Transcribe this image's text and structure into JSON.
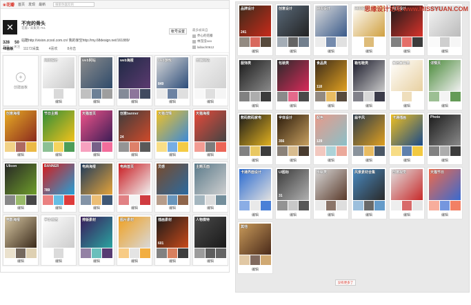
{
  "watermark": "思缘设计论坛 www.MISSYUAN.COM",
  "topbar": {
    "logo": "❀花瓣",
    "nav": [
      "首页",
      "发现",
      "最新"
    ],
    "search_placeholder": "搜索你喜欢的"
  },
  "profile": {
    "avatar_glyph": "✕",
    "name": "不完的骨头",
    "home": "花瓣 / 采集到:761",
    "desc": "站酷http://vision.zcool.com.cn/ 我的家空http://my.68design.net/161889/",
    "stats": [
      {
        "value": "328",
        "label": "粉丝"
      },
      {
        "value": "50",
        "label": "关注"
      }
    ],
    "account_button": "帐号设置",
    "followers_title": "最多被采自",
    "followers": [
      "乔心的花瓣",
      "林滢滢ooo",
      "laibach0612"
    ]
  },
  "tabs": [
    "48画板",
    "11172采集",
    "4喜欢",
    "8点击"
  ],
  "create_label": "创建画板",
  "edit_label": "编辑",
  "left_boards": [
    {
      "title": "网页设计",
      "count": "",
      "c1": "#ffffff",
      "c2": "#c9c9c9"
    },
    {
      "title": "web网站",
      "count": "",
      "c1": "#8d8d8d",
      "c2": "#2e4a6a"
    },
    {
      "title": "web海报",
      "count": "",
      "c1": "#1e2a44",
      "c2": "#5c3a70"
    },
    {
      "title": "web游戏",
      "count": "849",
      "c1": "#d9d9d9",
      "c2": "#2d4d7a"
    },
    {
      "title": "日韩网站",
      "count": "",
      "c1": "#f3f3f3",
      "c2": "#d2d2d2"
    },
    {
      "title": "创意海报",
      "count": "",
      "c1": "#e8ad24",
      "c2": "#8b2a1e"
    },
    {
      "title": "节日主题",
      "count": "",
      "c1": "#2e8c3a",
      "c2": "#f2c21a"
    },
    {
      "title": "天猫首页",
      "count": "",
      "c1": "#f0548a",
      "c2": "#3d1d56"
    },
    {
      "title": "创意banner",
      "count": "24",
      "c1": "#3c3c3c",
      "c2": "#d04a2a"
    },
    {
      "title": "天猫详情",
      "count": "",
      "c1": "#f2c224",
      "c2": "#3c8ad8"
    },
    {
      "title": "天猫海报",
      "count": "",
      "c1": "#e84a3a",
      "c2": "#444444"
    },
    {
      "title": "Ulicon",
      "count": "",
      "c1": "#262626",
      "c2": "#6e9d2a"
    },
    {
      "title": "BANNER",
      "count": "789",
      "c1": "#d81a1a",
      "c2": "#24a1d8"
    },
    {
      "title": "电商海报",
      "count": "",
      "c1": "#1d3a5c",
      "c2": "#e4a33a"
    },
    {
      "title": "电商首页",
      "count": "",
      "c1": "#c8191f",
      "c2": "#f0f0f0"
    },
    {
      "title": "灵感",
      "count": "",
      "c1": "#7a4a2a",
      "c2": "#2a6aa0"
    },
    {
      "title": "主题页面",
      "count": "",
      "c1": "#5a7a8a",
      "c2": "#cfcfcf"
    },
    {
      "title": "电影海报",
      "count": "",
      "c1": "#d8c8a4",
      "c2": "#3a2a1a"
    },
    {
      "title": "字体标志",
      "count": "",
      "c1": "#ffffff",
      "c2": "#cccccc"
    },
    {
      "title": "排版素材",
      "count": "",
      "c1": "#3a1a5a",
      "c2": "#2aa4a0"
    },
    {
      "title": "图片素材",
      "count": "",
      "c1": "#f0a020",
      "c2": "#d8d8d8"
    },
    {
      "title": "插画素材",
      "count": "601",
      "c1": "#1a1a1a",
      "c2": "#c84a1a"
    },
    {
      "title": "人物模特",
      "count": "",
      "c1": "#4a4a4a",
      "c2": "#1a1a1a"
    }
  ],
  "right_boards": [
    {
      "title": "品牌设计",
      "count": "241",
      "c1": "#3a2a1a",
      "c2": "#c82a1a"
    },
    {
      "title": "创意设计",
      "count": "",
      "c1": "#5a6a7a",
      "c2": "#222222"
    },
    {
      "title": "网页设计",
      "count": "",
      "c1": "#dcdcdc",
      "c2": "#3a5a8a"
    },
    {
      "title": "网页设计",
      "count": "",
      "c1": "#ffffff",
      "c2": "#d0a040"
    },
    {
      "title": "网页设计",
      "count": "",
      "c1": "#1a1a1a",
      "c2": "#d8322a"
    },
    {
      "title": "网页设计",
      "count": "",
      "c1": "#f5f5f5",
      "c2": "#bbbbbb"
    },
    {
      "title": "服饰类",
      "count": "",
      "c1": "#1a1a1a",
      "c2": "#8a8a8a"
    },
    {
      "title": "包装类",
      "count": "",
      "c1": "#2a2a2a",
      "c2": "#d82a5a"
    },
    {
      "title": "食品类",
      "count": "118",
      "c1": "#3a2a1a",
      "c2": "#e0a020"
    },
    {
      "title": "箱包鞋类",
      "count": "",
      "c1": "#1a1a2a",
      "c2": "#c8c8c8"
    },
    {
      "title": "家居家具类",
      "count": "",
      "c1": "#ffffff",
      "c2": "#e8d0a0"
    },
    {
      "title": "详情页",
      "count": "",
      "c1": "#4a8a3a",
      "c2": "#f0f0f0"
    },
    {
      "title": "数码数码家电",
      "count": "",
      "c1": "#1a1a1a",
      "c2": "#e0b020"
    },
    {
      "title": "字体设计",
      "count": "356",
      "c1": "#2a1a0a",
      "c2": "#c8a060"
    },
    {
      "title": "配色",
      "count": "129",
      "c1": "#e89a8a",
      "c2": "#8ac0c8"
    },
    {
      "title": "扁平风",
      "count": "",
      "c1": "#2a3a4a",
      "c2": "#e0a020"
    },
    {
      "title": "卡通插画",
      "count": "",
      "c1": "#f0c020",
      "c2": "#1a4a8a"
    },
    {
      "title": "Photo",
      "count": "",
      "c1": "#1a1a1a",
      "c2": "#8a8a8a"
    },
    {
      "title": "卡通界面设计",
      "count": "",
      "c1": "#2a6ad0",
      "c2": "#e0e0e0"
    },
    {
      "title": "UI图标",
      "count": "31",
      "c1": "#3a3a3a",
      "c2": "#b0b0b0"
    },
    {
      "title": "手绘类",
      "count": "",
      "c1": "#d8d8d8",
      "c2": "#5a3a2a"
    },
    {
      "title": "风景素材合集",
      "count": "",
      "c1": "#4a8ac0",
      "c2": "#2a2a2a"
    },
    {
      "title": "创意视觉",
      "count": "",
      "c1": "#e0e0e0",
      "c2": "#c82a2a"
    },
    {
      "title": "天猫节日",
      "count": "",
      "c1": "#f06a4a",
      "c2": "#3a6ad0"
    },
    {
      "title": "其他",
      "count": "",
      "c1": "#c89a5a",
      "c2": "#4a2a1a"
    }
  ],
  "more_button": "没有更多了"
}
